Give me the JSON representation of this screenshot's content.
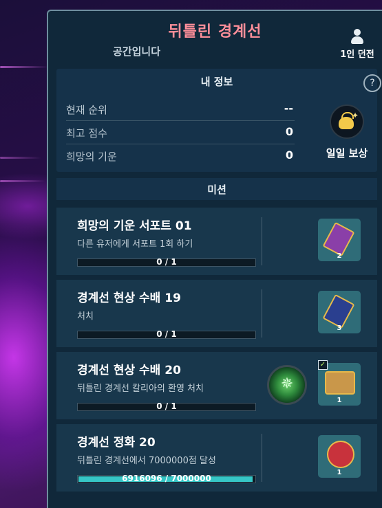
{
  "header": {
    "title": "뒤틀린 경계선",
    "subtitle": "공간입니다",
    "mode_label": "1인 던전",
    "mode_icon": "person-icon"
  },
  "info": {
    "header": "내 정보",
    "help_symbol": "?",
    "rows": [
      {
        "label": "현재 순위",
        "value": "--"
      },
      {
        "label": "최고 점수",
        "value": "0"
      },
      {
        "label": "희망의 기운",
        "value": "0"
      }
    ],
    "daily_reward_label": "일일 보상",
    "daily_reward_icon": "money-bag-icon"
  },
  "missions_header": "미션",
  "missions": [
    {
      "title": "희망의 기운 서포트 01",
      "desc": "다른 유저에게 서포트 1회 하기",
      "progress_text": "0 / 1",
      "progress": 0,
      "reward_qty": "2",
      "reward_icon": "ticket-icon",
      "reward_color": "#8a3fa8"
    },
    {
      "title": "경계선 현상 수배 19",
      "desc": "처치",
      "progress_text": "0 / 1",
      "progress": 0,
      "reward_qty": "3",
      "reward_icon": "ticket-icon",
      "reward_color": "#2a3f8f"
    },
    {
      "title": "경계선 현상 수배 20",
      "desc": "뒤틀린 경계선  칼리아의 환영 처치",
      "progress_text": "0 / 1",
      "progress": 0,
      "reward_qty": "1",
      "reward_icon": "treasure-chest-icon",
      "reward_color": "#c9974a",
      "boss_icon": "boss-emblem-icon",
      "check": "✓"
    },
    {
      "title": "경계선 정화 20",
      "desc": "뒤틀린 경계선에서 7000000점 달성",
      "progress_text": "6916096 / 7000000",
      "progress": 0.988,
      "reward_qty": "1",
      "reward_icon": "heart-medal-icon",
      "reward_color": "#c8323c"
    }
  ]
}
